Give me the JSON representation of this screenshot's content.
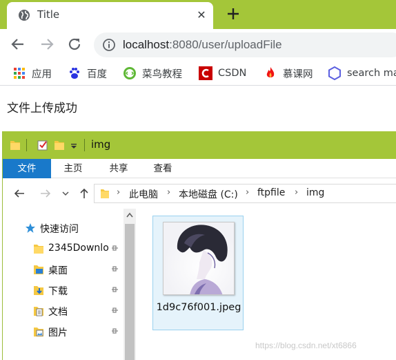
{
  "browser": {
    "tab": {
      "title": "Title"
    },
    "address": {
      "host": "localhost",
      "rest": ":8080/user/uploadFile"
    },
    "bookmarks": [
      {
        "icon": "apps-grid-icon",
        "label": "应用"
      },
      {
        "icon": "baidu-paw-icon",
        "label": "百度"
      },
      {
        "icon": "runoob-icon",
        "label": "菜鸟教程"
      },
      {
        "icon": "csdn-icon",
        "label": "CSDN"
      },
      {
        "icon": "imooc-flame-icon",
        "label": "慕课网"
      },
      {
        "icon": "hexagon-icon",
        "label": "search ma"
      }
    ]
  },
  "page": {
    "message": "文件上传成功"
  },
  "explorer": {
    "title": "img",
    "ribbon_tabs": [
      "文件",
      "主页",
      "共享",
      "查看"
    ],
    "breadcrumb": [
      "此电脑",
      "本地磁盘 (C:)",
      "ftpfile",
      "img"
    ],
    "nav_items": [
      {
        "label": "快速访问",
        "icon": "star-icon",
        "pinned": false
      },
      {
        "label": "2345Downlo",
        "icon": "folder-icon",
        "pinned": true
      },
      {
        "label": "桌面",
        "icon": "desktop-folder-icon",
        "pinned": true
      },
      {
        "label": "下载",
        "icon": "download-folder-icon",
        "pinned": true
      },
      {
        "label": "文档",
        "icon": "documents-icon",
        "pinned": true
      },
      {
        "label": "图片",
        "icon": "pictures-icon",
        "pinned": true
      }
    ],
    "file": {
      "name": "1d9c76f001.jpeg"
    }
  },
  "watermark": "https://blog.csdn.net/xt6866",
  "colors": {
    "accent": "#a4c639",
    "file_tab": "#1979ca",
    "selection": "#e5f3fb"
  }
}
